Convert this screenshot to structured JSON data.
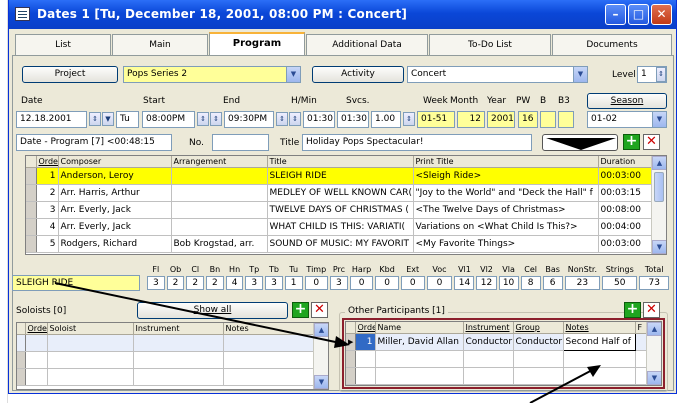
{
  "window": {
    "title": "Dates   1 [Tu, December  18, 2001, 08:00 PM : Concert]",
    "min_label": "–",
    "max_label": "□",
    "close_label": "✕"
  },
  "tabs": [
    {
      "label": "List"
    },
    {
      "label": "Main"
    },
    {
      "label": "Program"
    },
    {
      "label": "Additional Data"
    },
    {
      "label": "To-Do List"
    },
    {
      "label": "Documents"
    }
  ],
  "row1": {
    "project_button": "Project",
    "project_value": "Pops Series 2",
    "activity_button": "Activity",
    "activity_value": "Concert",
    "level_label": "Level",
    "level_value": "1"
  },
  "date_header": {
    "date": "Date",
    "start": "Start",
    "end": "End",
    "hmin": "H/Min",
    "svcs": "Svcs.",
    "week": "Week",
    "month": "Month",
    "year": "Year",
    "pw": "PW",
    "b": "B",
    "b3": "B3",
    "season_button": "Season"
  },
  "date_values": {
    "date": "12.18.2001",
    "day": "Tu",
    "start": "08:00PM",
    "end": "09:30PM",
    "hmin1": "01:30",
    "hmin2": "01:30",
    "svcs": "1.00",
    "week": "01-51",
    "month": "12",
    "year": "2001",
    "pw": "16",
    "b": "",
    "b3": "",
    "season": "01-02"
  },
  "program_row": {
    "program_combo": "Date - Program  [7]   <00:48:15",
    "no_label": "No.",
    "no_value": "",
    "title_label": "Title",
    "title_value": "Holiday Pops Spectacular!"
  },
  "program_table": {
    "headers": [
      "Order",
      "Composer",
      "Arrangement",
      "Title",
      "Print Title",
      "Duration"
    ],
    "rows": [
      {
        "order": "1",
        "composer": "Anderson, Leroy",
        "arrangement": "",
        "title": "SLEIGH RIDE",
        "print_title": "<Sleigh Ride>",
        "duration": "00:03:00"
      },
      {
        "order": "2",
        "composer": "Arr. Harris, Arthur",
        "arrangement": "",
        "title": "MEDLEY OF WELL KNOWN CAR(",
        "print_title": "\"Joy to the World\" and \"Deck the Hall\" f",
        "duration": "00:03:15"
      },
      {
        "order": "3",
        "composer": "Arr. Everly, Jack",
        "arrangement": "",
        "title": "TWELVE DAYS OF CHRISTMAS (",
        "print_title": "<The Twelve Days of Christmas>",
        "duration": "00:08:00"
      },
      {
        "order": "4",
        "composer": "Arr. Everly, Jack",
        "arrangement": "",
        "title": "WHAT CHILD IS THIS: VARIATI(",
        "print_title": "Variations on <What Child Is This?>",
        "duration": "00:04:00"
      },
      {
        "order": "5",
        "composer": "Rodgers, Richard",
        "arrangement": "Bob Krogstad, arr.",
        "title": "SOUND OF MUSIC: MY FAVORIT",
        "print_title": "<My Favorite Things>",
        "duration": "00:03:00"
      }
    ]
  },
  "instrumentation": {
    "selected_title": "SLEIGH RIDE",
    "headers": [
      "Fl",
      "Ob",
      "Cl",
      "Bn",
      "Hn",
      "Tp",
      "Tb",
      "Tu",
      "Timp",
      "Prc",
      "Harp",
      "Kbd",
      "Ext",
      "Voc",
      "Vl1",
      "Vl2",
      "Vla",
      "Cel",
      "Bas",
      "NonStr.",
      "Strings",
      "Total"
    ],
    "values": [
      "3",
      "2",
      "2",
      "2",
      "4",
      "3",
      "3",
      "1",
      "0",
      "3",
      "0",
      "0",
      "0",
      "0",
      "14",
      "12",
      "10",
      "8",
      "6",
      "23",
      "50",
      "73"
    ]
  },
  "soloists": {
    "label": "Soloists  [0]",
    "show_all": "Show all",
    "headers": [
      "Order",
      "Soloist",
      "Instrument",
      "Notes"
    ]
  },
  "participants": {
    "label": "Other Participants  [1]",
    "headers": [
      "Order",
      "Name",
      "Instrument",
      "Group",
      "Notes",
      "F"
    ],
    "rows": [
      {
        "order": "1",
        "name": "Miller, David Allan",
        "instrument": "Conductor",
        "group": "Conductor",
        "notes": "Second Half of",
        "f": ""
      }
    ]
  },
  "icons": {
    "plus": "+",
    "delete": "✕",
    "up": "▲",
    "down": "▼",
    "spin": "⇕"
  }
}
